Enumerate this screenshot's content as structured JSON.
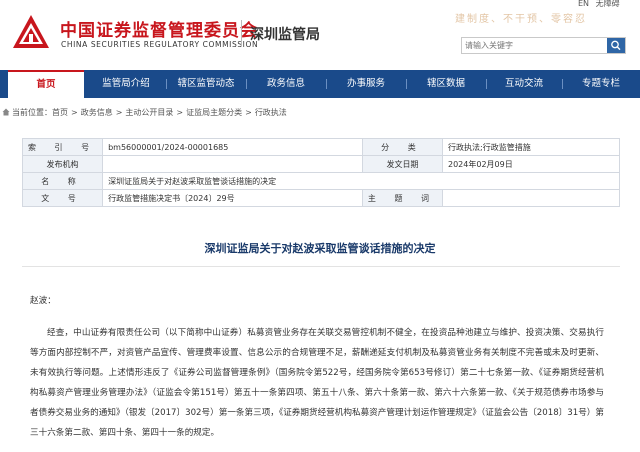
{
  "header": {
    "org_cn": "中国证券监督管理委员会",
    "org_en": "CHINA SECURITIES REGULATORY COMMISSION",
    "branch": "深圳监管局",
    "slogan": "建制度、不干预、零容忍",
    "tools": [
      "EN",
      "无障碍"
    ],
    "search_placeholder": "请输入关键字",
    "brand_color": "#c8161d"
  },
  "nav": {
    "items": [
      "首页",
      "监管局介绍",
      "辖区监管动态",
      "政务信息",
      "办事服务",
      "辖区数据",
      "互动交流",
      "专题专栏"
    ],
    "active": "首页",
    "bg_color": "#1a4a8a"
  },
  "breadcrumb": {
    "prefix": "当前位置：",
    "items": [
      "首页",
      "政务信息",
      "主动公开目录",
      "证监局主题分类",
      "行政执法"
    ]
  },
  "info": {
    "index_label": "索 引 号",
    "index_value": "bm56000001/2024-00001685",
    "category_label": "分 类",
    "category_value": "行政执法;行政监管措施",
    "issuer_label": "发布机构",
    "issuer_value": "",
    "date_label": "发文日期",
    "date_value": "2024年02月09日",
    "name_label": "名 称",
    "name_value": "深圳证监局关于对赵波采取监管谈话措施的决定",
    "docno_label": "文 号",
    "docno_value": "行政监管措施决定书〔2024〕29号",
    "keyword_label": "主 题 词",
    "keyword_value": ""
  },
  "document": {
    "title": "深圳证监局关于对赵波采取监管谈话措施的决定",
    "addressee": "赵波：",
    "paragraph": "经查，中山证券有限责任公司（以下简称中山证券）私募资管业务存在关联交易管控机制不健全，在投资品种池建立与维护、投资决策、交易执行等方面内部控制不严，对资管产品宣传、管理费率设置、信息公示的合规管理不足，薪酬递延支付机制及私募资管业务有关制度不完善或未及时更新、未有效执行等问题。上述情形违反了《证券公司监督管理条例》（国务院令第522号，经国务院令第653号修订）第二十七条第一款、《证券期货经营机构私募资产管理业务管理办法》（证监会令第151号）第五十一条第四项、第五十八条、第六十条第一款、第六十六条第一款、《关于规范债券市场参与者债券交易业务的通知》（银发〔2017〕302号）第一条第三项，《证券期货经营机构私募资产管理计划运作管理规定》（证监会公告〔2018〕31号）第三十六条第二款、第四十条、第四十一条的规定。"
  }
}
